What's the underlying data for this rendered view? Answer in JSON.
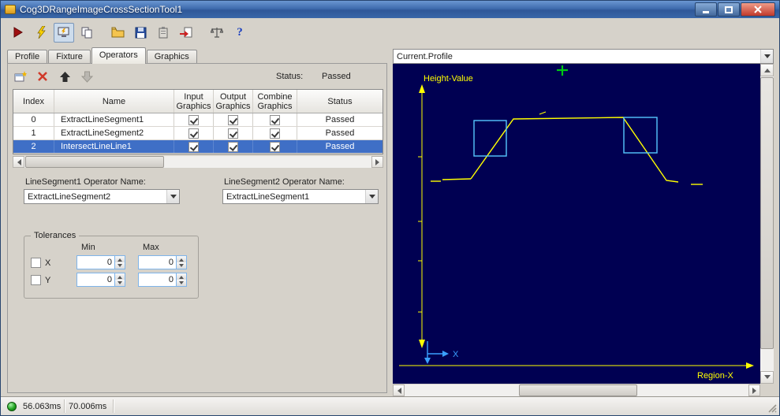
{
  "window": {
    "title": "Cog3DRangeImageCrossSectionTool1"
  },
  "toolbar": {
    "icons": [
      "run-icon",
      "electric-trigger-icon",
      "live-display-icon",
      "copy-results-icon",
      "open-file-icon",
      "save-file-icon",
      "clipboard-icon",
      "import-icon",
      "calibration-icon",
      "help-icon"
    ],
    "help_glyph": "?"
  },
  "tabs": {
    "items": [
      {
        "label": "Profile"
      },
      {
        "label": "Fixture"
      },
      {
        "label": "Operators"
      },
      {
        "label": "Graphics"
      }
    ],
    "active": "Operators"
  },
  "operators_page": {
    "status_label": "Status:",
    "status_value": "Passed",
    "table": {
      "headers": {
        "index": "Index",
        "name": "Name",
        "input": "Input\nGraphics",
        "output": "Output\nGraphics",
        "combine": "Combine\nGraphics",
        "status": "Status"
      },
      "rows": [
        {
          "index": "0",
          "name": "ExtractLineSegment1",
          "input_checked": true,
          "output_checked": true,
          "combine_checked": true,
          "status": "Passed"
        },
        {
          "index": "1",
          "name": "ExtractLineSegment2",
          "input_checked": true,
          "output_checked": true,
          "combine_checked": true,
          "status": "Passed"
        },
        {
          "index": "2",
          "name": "IntersectLineLine1",
          "input_checked": true,
          "output_checked": true,
          "combine_checked": true,
          "status": "Passed"
        }
      ],
      "selected_row": 2
    },
    "segment1": {
      "label": "LineSegment1 Operator Name:",
      "value": "ExtractLineSegment2"
    },
    "segment2": {
      "label": "LineSegment2 Operator Name:",
      "value": "ExtractLineSegment1"
    },
    "tolerances": {
      "title": "Tolerances",
      "min_header": "Min",
      "max_header": "Max",
      "x": {
        "label": "X",
        "checked": false,
        "min": "0",
        "max": "0"
      },
      "y": {
        "label": "Y",
        "checked": false,
        "min": "0",
        "max": "0"
      }
    }
  },
  "profile_panel": {
    "selector_value": "Current.Profile",
    "y_axis_label": "Height-Value",
    "x_axis_label": "Region-X",
    "origin_label": "X",
    "colors": {
      "background": "#000052",
      "profile_line": "#ffff00",
      "region_marker": "#55c8ff",
      "cursor_cross": "#00c814",
      "origin_axes": "#3aa0ff"
    }
  },
  "status_bar": {
    "process_time": "56.063ms",
    "total_time": "70.006ms"
  }
}
